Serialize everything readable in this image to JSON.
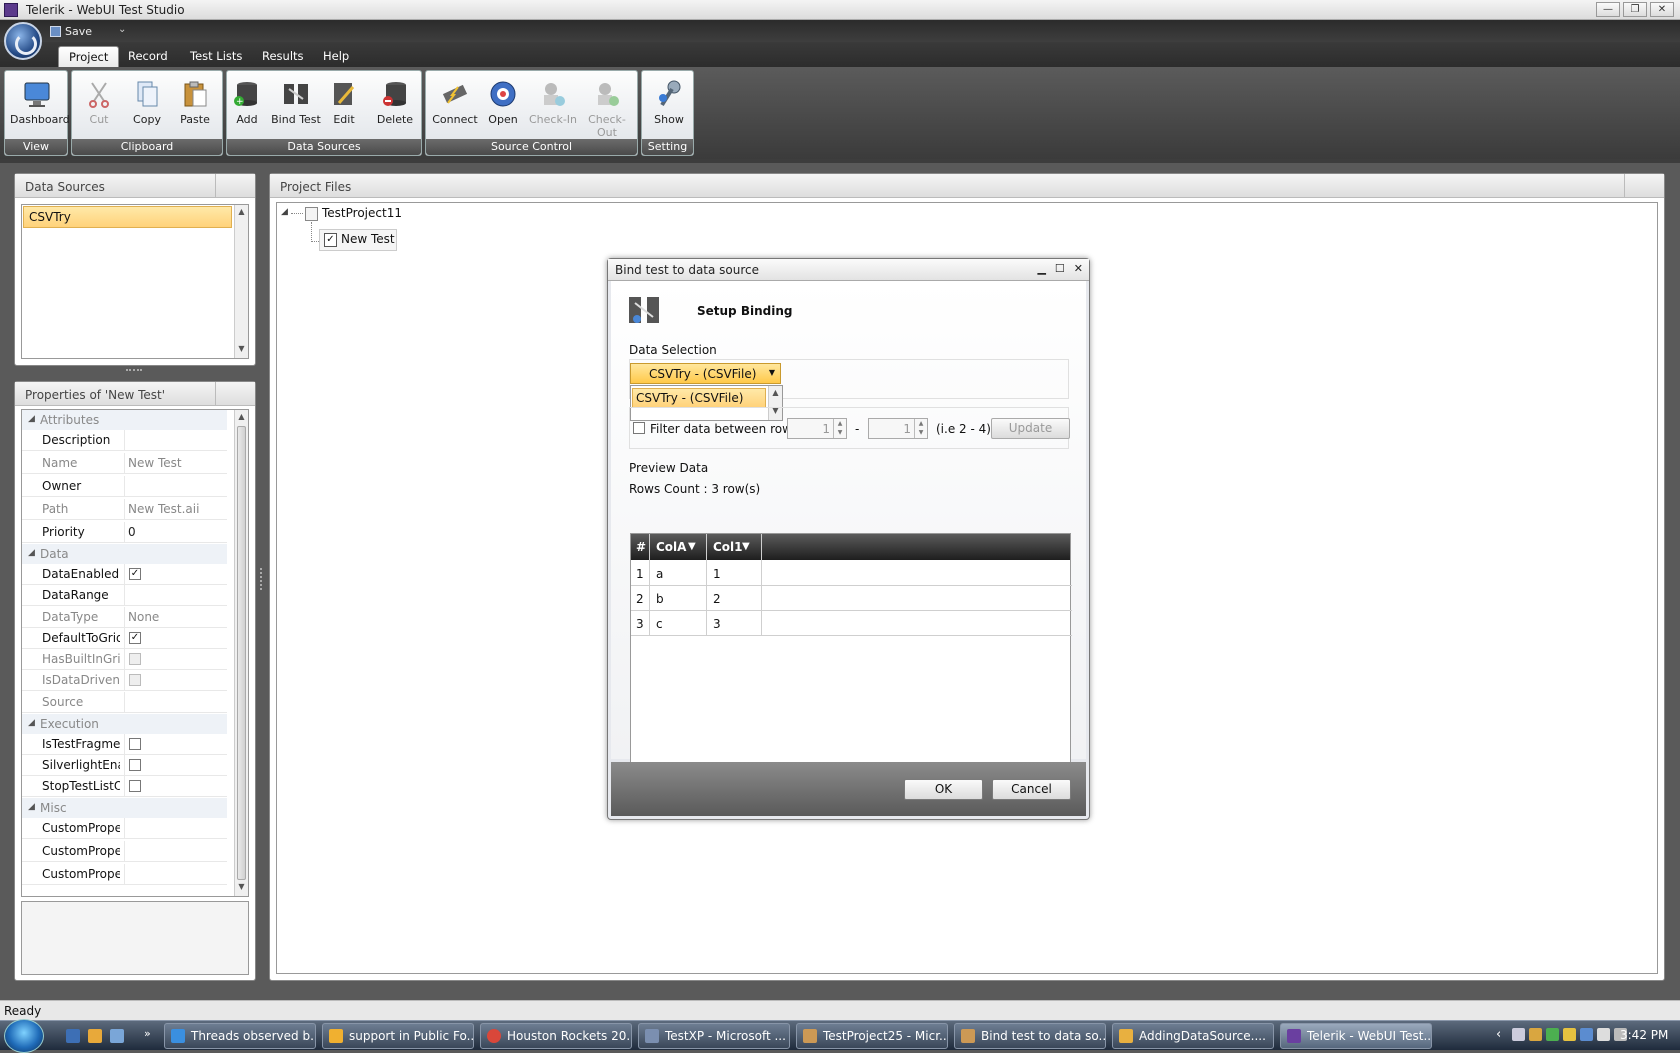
{
  "window": {
    "title": "Telerik - WebUI Test Studio",
    "min": "—",
    "max": "❐",
    "close": "✕"
  },
  "qat": {
    "save_label": "Save",
    "dropdown": "⌄"
  },
  "tabs": [
    "Project",
    "Record",
    "Test Lists",
    "Results",
    "Help"
  ],
  "ribbon": {
    "groups": {
      "view": "View",
      "clipboard": "Clipboard",
      "datasources": "Data Sources",
      "sourcecontrol": "Source Control",
      "setting": "Setting"
    },
    "buttons": {
      "dashboard": "Dashboard",
      "cut": "Cut",
      "copy": "Copy",
      "paste": "Paste",
      "add": "Add",
      "bindtest": "Bind Test",
      "edit": "Edit",
      "delete": "Delete",
      "connect": "Connect",
      "open": "Open",
      "checkin": "Check-In",
      "checkout": "Check-Out",
      "show": "Show"
    }
  },
  "datasources": {
    "title": "Data Sources",
    "items": [
      "CSVTry"
    ]
  },
  "properties": {
    "title": "Properties of 'New Test'",
    "categories": {
      "attributes": "Attributes",
      "data": "Data",
      "execution": "Execution",
      "misc": "Misc"
    },
    "rows": {
      "description": {
        "k": "Description",
        "v": ""
      },
      "name": {
        "k": "Name",
        "v": "New Test"
      },
      "owner": {
        "k": "Owner",
        "v": ""
      },
      "path": {
        "k": "Path",
        "v": "New Test.aii"
      },
      "priority": {
        "k": "Priority",
        "v": "0"
      },
      "dataenabled": {
        "k": "DataEnabled"
      },
      "datarange": {
        "k": "DataRange"
      },
      "datatype": {
        "k": "DataType",
        "v": "None"
      },
      "defaulttogrid": {
        "k": "DefaultToGrid"
      },
      "hasbuiltingrid": {
        "k": "HasBuiltInGrid"
      },
      "isdatadriven": {
        "k": "IsDataDriven"
      },
      "source": {
        "k": "Source"
      },
      "istestfragment": {
        "k": "IsTestFragment"
      },
      "silverlight": {
        "k": "SilverlightEnabl"
      },
      "stoptestlist": {
        "k": "StopTestListOn"
      },
      "custom1": {
        "k": "CustomPropert"
      },
      "custom2": {
        "k": "CustomPropert"
      },
      "custom3": {
        "k": "CustomPropert"
      }
    }
  },
  "projectfiles": {
    "title": "Project Files",
    "project": "TestProject11",
    "test": "New Test"
  },
  "dialog": {
    "title": "Bind test to data source",
    "heading": "Setup Binding",
    "data_selection_label": "Data Selection",
    "combo_value": "CSVTry - (CSVFile)",
    "dropdown_item": "CSVTry - (CSVFile)",
    "filter_label": "Filter data between rows:",
    "from": "1",
    "to": "1",
    "dash": "-",
    "hint": "(i.e 2 - 4)",
    "update": "Update",
    "preview_label": "Preview Data",
    "rows_count": "Rows Count : 3 row(s)",
    "grid": {
      "headers": [
        "#",
        "ColA",
        "Col1"
      ],
      "rows": [
        [
          "1",
          "a",
          "1"
        ],
        [
          "2",
          "b",
          "2"
        ],
        [
          "3",
          "c",
          "3"
        ]
      ]
    },
    "ok": "OK",
    "cancel": "Cancel"
  },
  "status": "Ready",
  "taskbar": {
    "items": [
      "Threads observed b...",
      "support in Public Fo...",
      "Houston Rockets 20...",
      "TestXP - Microsoft ...",
      "TestProject25 - Micr...",
      "Bind test to data so...",
      "AddingDataSource....",
      "Telerik - WebUI Test..."
    ],
    "clock": "3:42 PM",
    "chevron": "‹"
  }
}
